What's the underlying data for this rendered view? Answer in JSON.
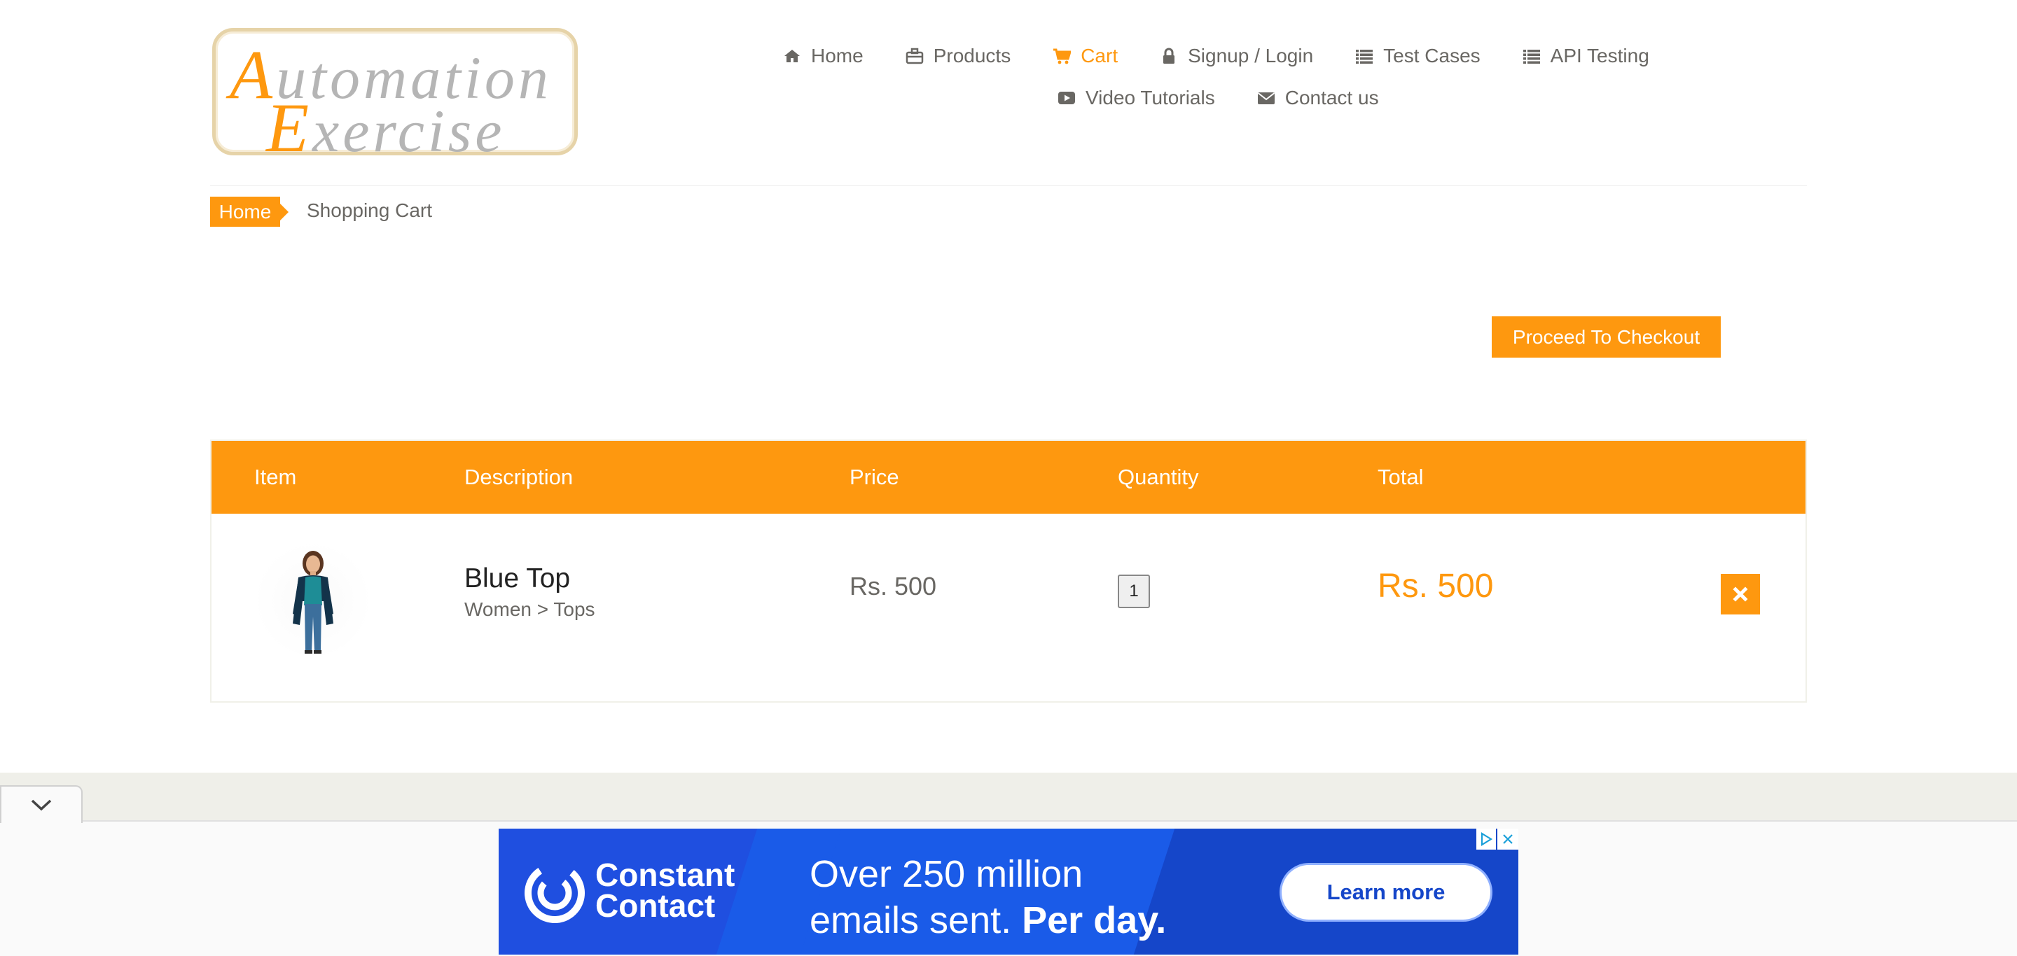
{
  "logo": {
    "line1_cap": "A",
    "line1_rest": "utomation",
    "line2_cap": "E",
    "line2_rest": "xercise"
  },
  "nav": {
    "row1": [
      {
        "label": "Home",
        "icon": "home-icon"
      },
      {
        "label": "Products",
        "icon": "briefcase-icon"
      },
      {
        "label": "Cart",
        "icon": "cart-icon",
        "active": true
      },
      {
        "label": "Signup / Login",
        "icon": "lock-icon"
      },
      {
        "label": "Test Cases",
        "icon": "list-icon"
      },
      {
        "label": "API Testing",
        "icon": "list-icon"
      }
    ],
    "row2": [
      {
        "label": "Video Tutorials",
        "icon": "youtube-play-icon"
      },
      {
        "label": "Contact us",
        "icon": "envelope-icon"
      }
    ]
  },
  "breadcrumb": {
    "home": "Home",
    "current": "Shopping Cart"
  },
  "checkout": {
    "label": "Proceed To Checkout"
  },
  "cart": {
    "headers": {
      "item": "Item",
      "description": "Description",
      "price": "Price",
      "quantity": "Quantity",
      "total": "Total"
    },
    "rows": [
      {
        "name": "Blue Top",
        "category": "Women > Tops",
        "price": "Rs. 500",
        "quantity": "1",
        "total": "Rs. 500",
        "image": "woman-blue-top-photo"
      }
    ]
  },
  "ad": {
    "brand_line1": "Constant",
    "brand_line2": "Contact",
    "headline_line1": "Over 250 million",
    "headline_line2_a": "emails sent. ",
    "headline_line2_b": "Per day.",
    "cta": "Learn more"
  },
  "colors": {
    "accent": "#fe980f",
    "text": "#696763",
    "ad_blue": "#1a5be8"
  }
}
